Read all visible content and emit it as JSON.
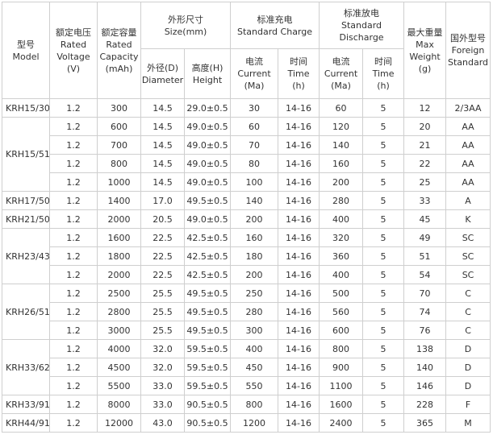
{
  "headers": {
    "model": [
      "型号",
      "Model"
    ],
    "voltage": [
      "额定电压",
      "Rated",
      "Voltage",
      "(V)"
    ],
    "capacity": [
      "额定容量",
      "Rated",
      "Capacity",
      "(mAh)"
    ],
    "size": [
      "外形尺寸",
      "Size(mm)"
    ],
    "charge": [
      "标准充电",
      "Standard Charge"
    ],
    "discharge": [
      "标准放电",
      "Standard",
      "Discharge"
    ],
    "weight": [
      "最大重量",
      "Max",
      "Weight",
      "(g)"
    ],
    "foreign": [
      "国外型号",
      "Foreign",
      "Standard"
    ],
    "diameter": [
      "外径(D)",
      "Diameter"
    ],
    "height": [
      "高度(H)",
      "Height"
    ],
    "ch_current": [
      "电流",
      "Current",
      "(Ma)"
    ],
    "ch_time": [
      "时间",
      "Time",
      "(h)"
    ],
    "dis_current": [
      "电流",
      "Current",
      "(Ma)"
    ],
    "dis_time": [
      "时间",
      "Time",
      "(h)"
    ]
  },
  "groups": [
    {
      "model": "KRH15/30",
      "rows": [
        [
          "1.2",
          "300",
          "14.5",
          "29.0±0.5",
          "30",
          "14-16",
          "60",
          "5",
          "12",
          "2/3AA"
        ]
      ]
    },
    {
      "model": "KRH15/51",
      "rows": [
        [
          "1.2",
          "600",
          "14.5",
          "49.0±0.5",
          "60",
          "14-16",
          "120",
          "5",
          "20",
          "AA"
        ],
        [
          "1.2",
          "700",
          "14.5",
          "49.0±0.5",
          "70",
          "14-16",
          "140",
          "5",
          "21",
          "AA"
        ],
        [
          "1.2",
          "800",
          "14.5",
          "49.0±0.5",
          "80",
          "14-16",
          "160",
          "5",
          "22",
          "AA"
        ],
        [
          "1.2",
          "1000",
          "14.5",
          "49.0±0.5",
          "100",
          "14-16",
          "200",
          "5",
          "25",
          "AA"
        ]
      ]
    },
    {
      "model": "KRH17/50",
      "rows": [
        [
          "1.2",
          "1400",
          "17.0",
          "49.5±0.5",
          "140",
          "14-16",
          "280",
          "5",
          "33",
          "A"
        ]
      ]
    },
    {
      "model": "KRH21/50",
      "rows": [
        [
          "1.2",
          "2000",
          "20.5",
          "49.0±0.5",
          "200",
          "14-16",
          "400",
          "5",
          "45",
          "K"
        ]
      ]
    },
    {
      "model": "KRH23/43",
      "rows": [
        [
          "1.2",
          "1600",
          "22.5",
          "42.5±0.5",
          "160",
          "14-16",
          "320",
          "5",
          "49",
          "SC"
        ],
        [
          "1.2",
          "1800",
          "22.5",
          "42.5±0.5",
          "180",
          "14-16",
          "360",
          "5",
          "51",
          "SC"
        ],
        [
          "1.2",
          "2000",
          "22.5",
          "42.5±0.5",
          "200",
          "14-16",
          "400",
          "5",
          "54",
          "SC"
        ]
      ]
    },
    {
      "model": "KRH26/51",
      "rows": [
        [
          "1.2",
          "2500",
          "25.5",
          "49.5±0.5",
          "250",
          "14-16",
          "500",
          "5",
          "70",
          "C"
        ],
        [
          "1.2",
          "2800",
          "25.5",
          "49.5±0.5",
          "280",
          "14-16",
          "560",
          "5",
          "74",
          "C"
        ],
        [
          "1.2",
          "3000",
          "25.5",
          "49.5±0.5",
          "300",
          "14-16",
          "600",
          "5",
          "76",
          "C"
        ]
      ]
    },
    {
      "model": "KRH33/62",
      "rows": [
        [
          "1.2",
          "4000",
          "32.0",
          "59.5±0.5",
          "400",
          "14-16",
          "800",
          "5",
          "138",
          "D"
        ],
        [
          "1.2",
          "4500",
          "32.0",
          "59.5±0.5",
          "450",
          "14-16",
          "900",
          "5",
          "140",
          "D"
        ],
        [
          "1.2",
          "5500",
          "33.0",
          "59.5±0.5",
          "550",
          "14-16",
          "1100",
          "5",
          "146",
          "D"
        ]
      ]
    },
    {
      "model": "KRH33/91",
      "rows": [
        [
          "1.2",
          "8000",
          "33.0",
          "90.5±0.5",
          "800",
          "14-16",
          "1600",
          "5",
          "228",
          "F"
        ]
      ]
    },
    {
      "model": "KRH44/91",
      "rows": [
        [
          "1.2",
          "12000",
          "43.0",
          "90.5±0.5",
          "1200",
          "14-16",
          "2400",
          "5",
          "365",
          "M"
        ]
      ]
    }
  ]
}
